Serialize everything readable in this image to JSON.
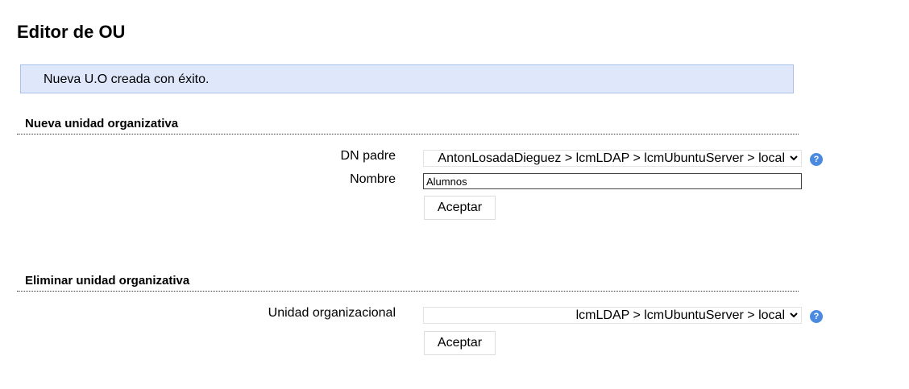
{
  "page": {
    "title": "Editor de OU"
  },
  "message": {
    "text": "Nueva U.O creada con éxito."
  },
  "new_ou": {
    "section_title": "Nueva unidad organizativa",
    "parent_dn_label": "DN padre",
    "parent_dn_value": "AntonLosadaDieguez > lcmLDAP > lcmUbuntuServer > local",
    "name_label": "Nombre",
    "name_value": "Alumnos",
    "submit_label": "Aceptar",
    "help_icon": "help-icon"
  },
  "delete_ou": {
    "section_title": "Eliminar unidad organizativa",
    "ou_label": "Unidad organizacional",
    "ou_value": "lcmLDAP > lcmUbuntuServer > local",
    "submit_label": "Aceptar",
    "help_icon": "help-icon"
  },
  "colors": {
    "message_bg": "#dfe8fb",
    "message_border": "#a9c1ec",
    "help_icon": "#4a8be0"
  }
}
